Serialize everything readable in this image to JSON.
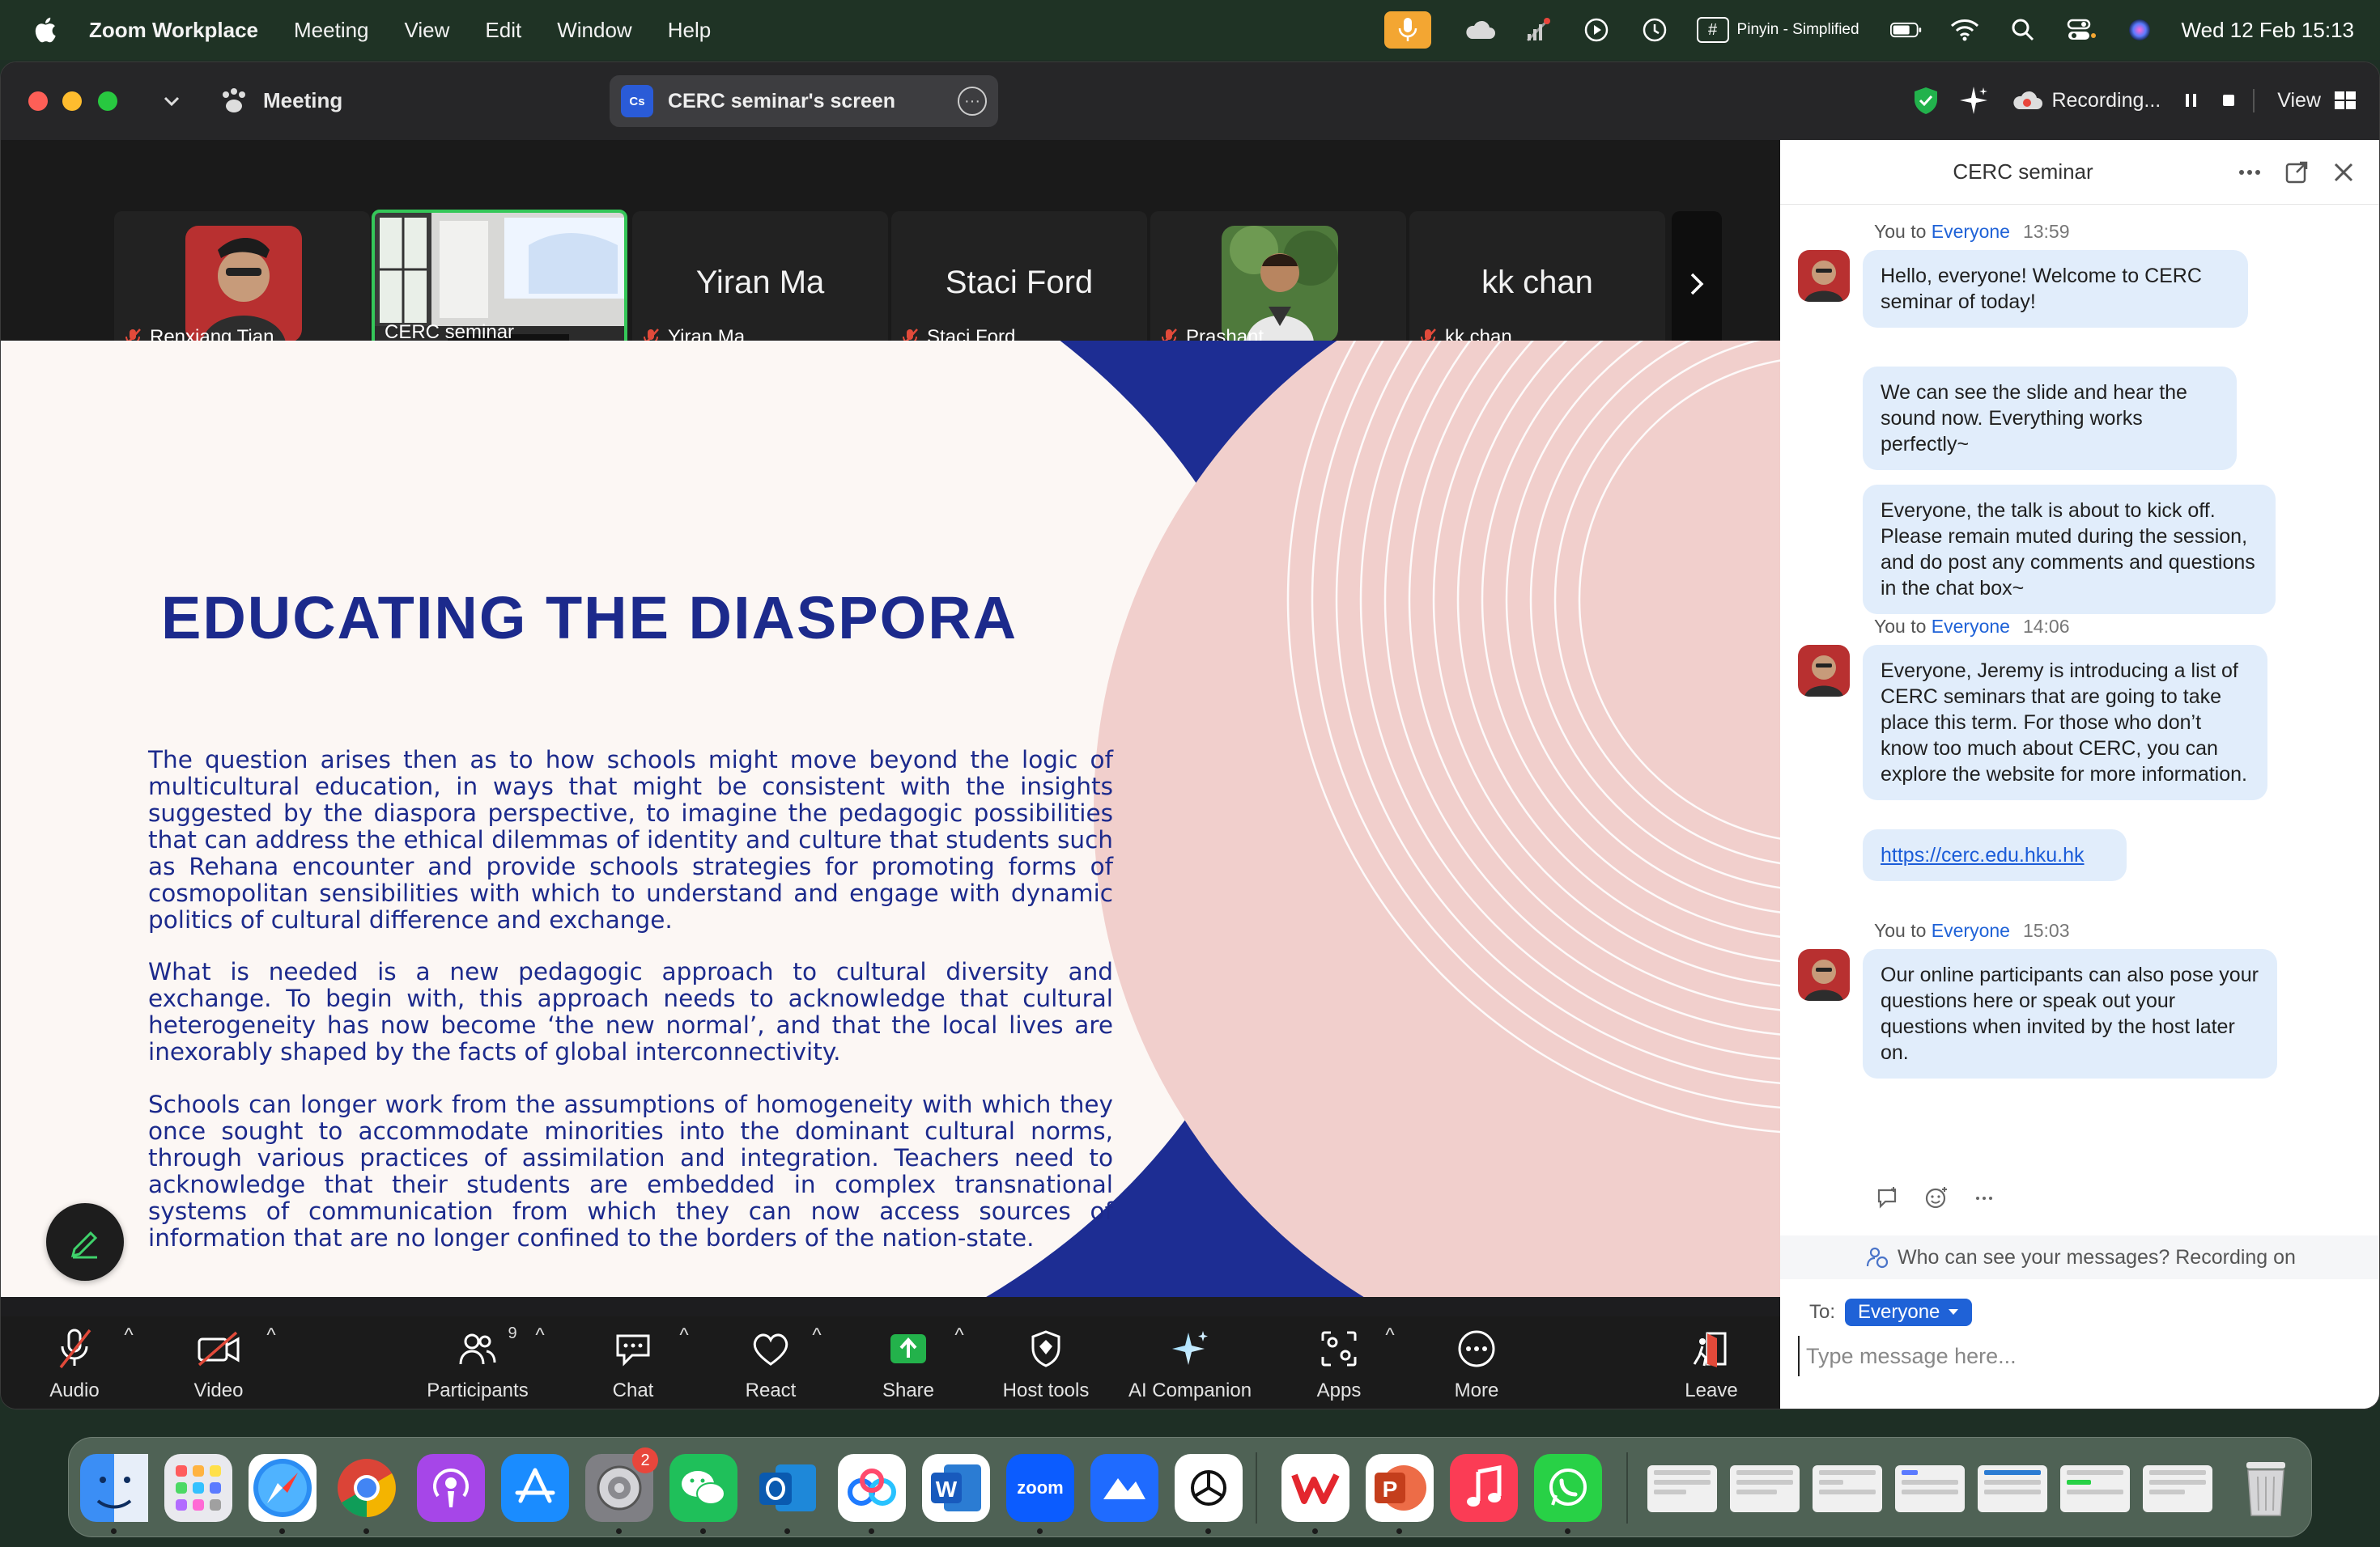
{
  "menubar": {
    "app_name": "Zoom Workplace",
    "menus": [
      "Meeting",
      "View",
      "Edit",
      "Window",
      "Help"
    ],
    "input_method": "Pinyin - Simplified",
    "clock": "Wed 12 Feb  15:13",
    "icons": [
      "microphone-icon",
      "cloud-icon",
      "wifi-calling-icon",
      "play-icon",
      "time-machine-icon",
      "keyboard-icon",
      "battery-icon",
      "wifi-icon",
      "spotlight-icon",
      "control-center-icon",
      "siri-icon"
    ]
  },
  "titlebar": {
    "meeting_label": "Meeting",
    "screen_pill_initials": "Cs",
    "screen_pill_label": "CERC seminar's screen",
    "recording_label": "Recording...",
    "view_label": "View"
  },
  "gallery": {
    "participants": [
      {
        "name": "Renxiang Tian",
        "big_name": "",
        "muted": true
      },
      {
        "name": "CERC seminar",
        "big_name": "",
        "muted": false
      },
      {
        "name": "Yiran Ma",
        "big_name": "Yiran Ma",
        "muted": true
      },
      {
        "name": "Staci Ford",
        "big_name": "Staci Ford",
        "muted": true
      },
      {
        "name": "Prashant",
        "big_name": "",
        "muted": true
      },
      {
        "name": "kk chan",
        "big_name": "kk chan",
        "muted": true
      }
    ]
  },
  "slide": {
    "title": "EDUCATING THE DIASPORA",
    "paragraphs": [
      "The question arises then as to how schools might move beyond the logic of multicultural education, in ways that might be consistent with the insights suggested by the diaspora perspective, to imagine the pedagogic possibilities that can address the ethical dilemmas of identity and culture that students such as Rehana encounter and provide schools strategies for promoting forms of cosmopolitan sensibilities with which to understand and engage with dynamic politics of cultural difference and exchange.",
      "What is needed is a new pedagogic approach to cultural diversity and exchange. To begin with, this approach needs to acknowledge that cultural heterogeneity has now become ‘the new normal’, and that the local lives are inexorably shaped by the facts of global interconnectivity.",
      "Schools can longer work from the assumptions of homogeneity with which they once sought to accommodate minorities into the dominant cultural norms, through various practices of assimilation and integration. Teachers need to acknowledge that their students are embedded in complex transnational systems of communication from which they can now access sources of information that are no longer confined to the borders of the nation-state."
    ],
    "colors": {
      "navy": "#1c2a8c",
      "pink": "#f1cfcc",
      "cream": "#fcf7f4"
    }
  },
  "toolbar": {
    "audio": "Audio",
    "video": "Video",
    "participants": "Participants",
    "participants_count": "9",
    "chat": "Chat",
    "react": "React",
    "share": "Share",
    "host_tools": "Host tools",
    "ai_companion": "AI Companion",
    "apps": "Apps",
    "more": "More",
    "leave": "Leave"
  },
  "chat": {
    "title": "CERC seminar",
    "groups": [
      {
        "sender": "You to ",
        "recipient": "Everyone",
        "time": "13:59",
        "messages": [
          "Hello, everyone! Welcome to CERC seminar of today!",
          "We can see the slide and hear the sound now. Everything works perfectly~",
          "Everyone, the talk is about to kick off. Please remain muted during the session, and do post any comments and questions in the chat box~"
        ]
      },
      {
        "sender": "You to ",
        "recipient": "Everyone",
        "time": "14:06",
        "messages": [
          "Everyone, Jeremy is introducing a list of CERC seminars that are going to take place this term. For those who don’t know too much about CERC, you can explore the website for more information."
        ],
        "link": "https://cerc.edu.hku.hk"
      },
      {
        "sender": "You to ",
        "recipient": "Everyone",
        "time": "15:03",
        "messages": [
          "Our online participants can also pose your questions here or speak out your questions when invited by the host later on."
        ]
      }
    ],
    "visibility_notice": "Who can see your messages? Recording on",
    "to_label": "To:",
    "to_value": "Everyone",
    "input_placeholder": "Type message here..."
  },
  "dock": {
    "apps": [
      "finder-icon",
      "launchpad-icon",
      "safari-icon",
      "chrome-icon",
      "podcasts-icon",
      "app-store-icon",
      "system-settings-icon",
      "wechat-icon",
      "outlook-icon",
      "baidu-netdisk-icon",
      "word-icon",
      "zoom-icon",
      "lark-icon",
      "chatgpt-icon",
      "wps-icon",
      "powerpoint-icon",
      "music-icon",
      "whatsapp-icon"
    ],
    "settings_badge": "2",
    "zoom_label": "zoom",
    "word_label": "W",
    "ppt_label": "P"
  }
}
